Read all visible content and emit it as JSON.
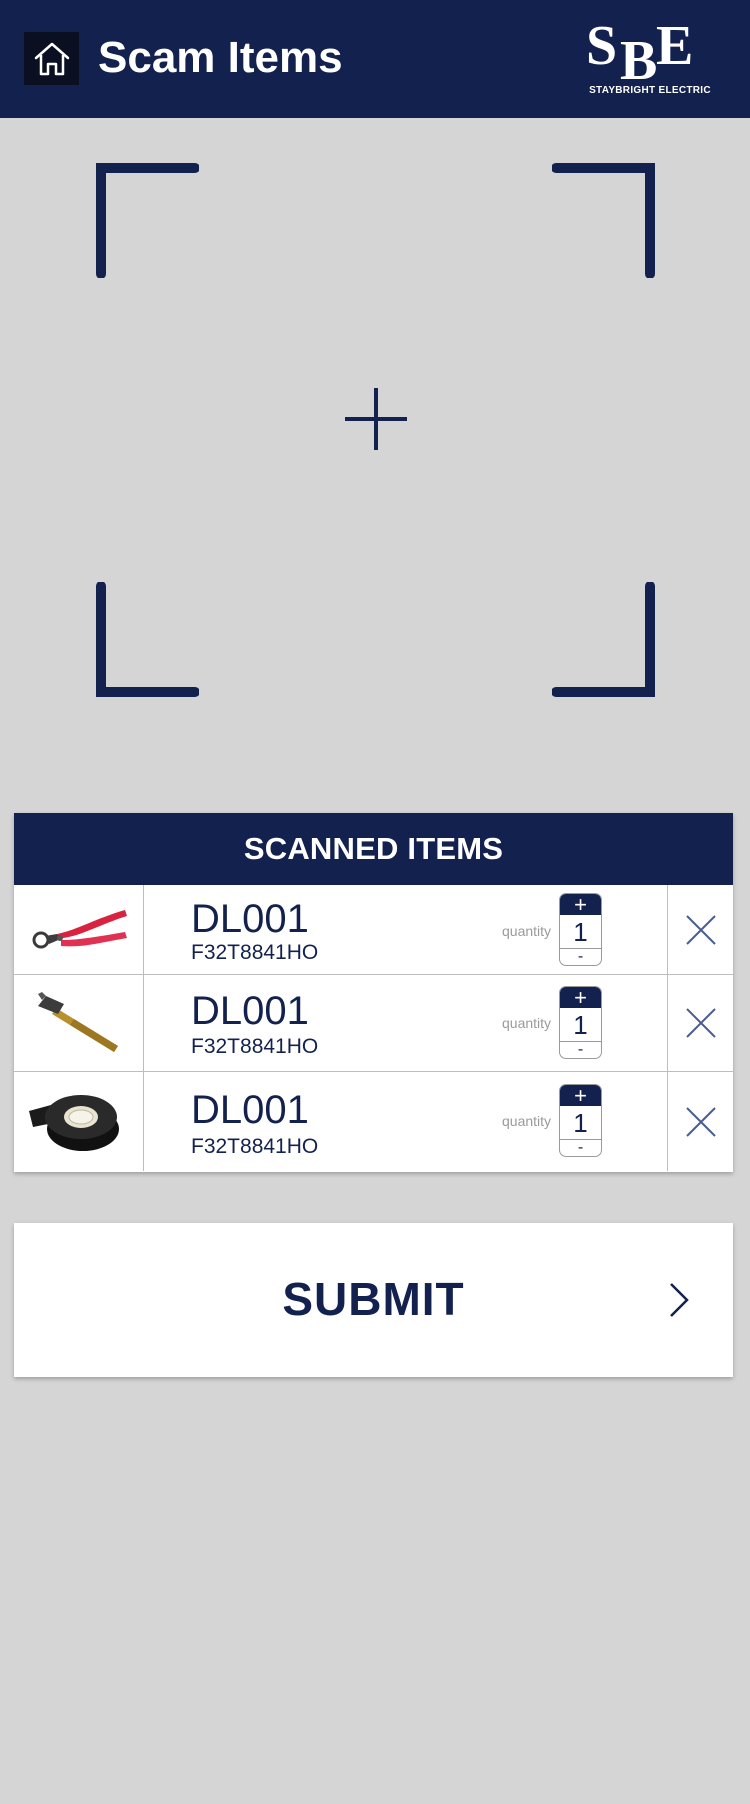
{
  "header": {
    "title": "Scam Items",
    "home_icon": "home-icon",
    "logo": {
      "monogram": "SBE",
      "name": "STAYBRIGHT ELECTRIC"
    }
  },
  "scanner": {
    "frame": "viewfinder-corners",
    "crosshair_icon": "crosshair-icon"
  },
  "scanned": {
    "title": "SCANNED ITEMS",
    "items": [
      {
        "image": "cable-cutter-pliers",
        "code": "DL001",
        "sku": "F32T8841HO",
        "quantity_label": "quantity",
        "quantity": "1",
        "plus": "+",
        "minus": "-"
      },
      {
        "image": "claw-hammer",
        "code": "DL001",
        "sku": "F32T8841HO",
        "quantity_label": "quantity",
        "quantity": "1",
        "plus": "+",
        "minus": "-"
      },
      {
        "image": "electrical-tape-roll",
        "code": "DL001",
        "sku": "F32T8841HO",
        "quantity_label": "quantity",
        "quantity": "1",
        "plus": "+",
        "minus": "-"
      }
    ]
  },
  "submit": {
    "label": "SUBMIT",
    "arrow_icon": "chevron-right-icon"
  },
  "colors": {
    "brand_navy": "#13214f",
    "background": "#d5d5d5",
    "home_button_bg": "#0a0f22"
  }
}
